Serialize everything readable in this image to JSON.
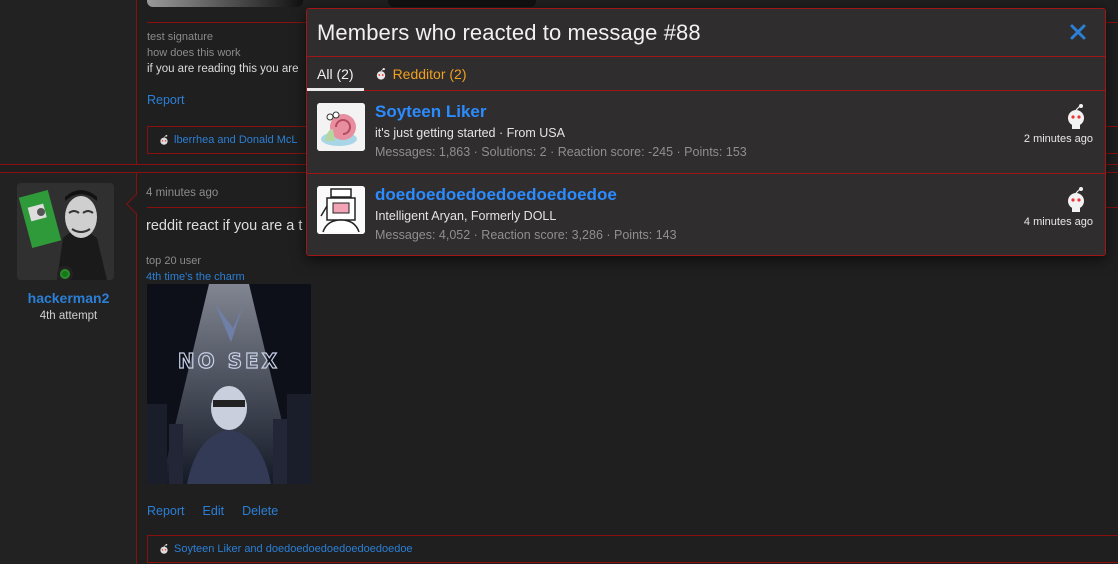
{
  "post1": {
    "signature_line1": "test signature",
    "signature_line2": "how does this work",
    "signature_line3": "if you are reading this you are",
    "report_label": "Report",
    "reactions_text": "lberrhea and Donald McL"
  },
  "post2": {
    "username": "hackerman2",
    "user_title": "4th attempt",
    "timestamp": "4 minutes ago",
    "body": "reddit react if you are a t",
    "signature_line1": "top 20 user",
    "signature_link": "4th time's the charm",
    "image_text": "NO SEX",
    "actions": {
      "report": "Report",
      "edit": "Edit",
      "delete": "Delete"
    },
    "reactions_text": "Soyteen Liker and doedoedoedoedoedoedoedoe"
  },
  "modal": {
    "title": "Members who reacted to message #88",
    "close_icon": "close-icon",
    "tabs": [
      {
        "label": "All (2)",
        "active": true
      },
      {
        "label": "Redditor (2)",
        "icon": "redditor-icon",
        "color": "#f0a020"
      }
    ],
    "members": [
      {
        "name": "Soyteen Liker",
        "subtitle": "it's just getting started · From USA",
        "stats": "Messages: 1,863 · Solutions: 2 · Reaction score: -245 · Points: 153",
        "time": "2 minutes ago",
        "reaction_icon": "redditor-icon"
      },
      {
        "name": "doedoedoedoedoedoedoedoe",
        "subtitle": "Intelligent Aryan, Formerly DOLL",
        "stats": "Messages: 4,052 · Reaction score: 3,286 · Points: 143",
        "time": "4 minutes ago",
        "reaction_icon": "redditor-icon"
      }
    ]
  },
  "colors": {
    "accent_blue": "#2b8cff",
    "border_red": "#a01515",
    "redditor_orange": "#f0a020",
    "online_green": "#127a12"
  }
}
